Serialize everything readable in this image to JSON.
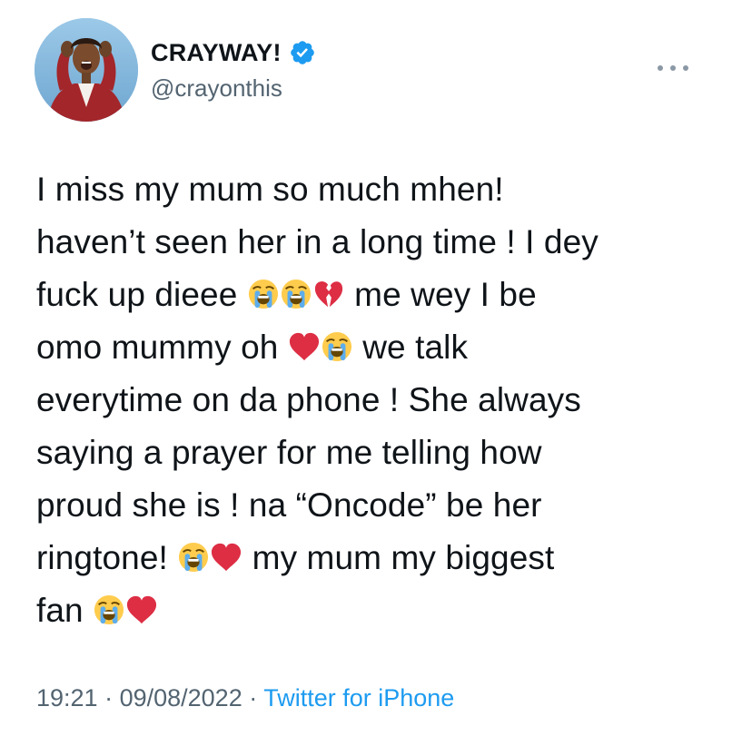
{
  "author": {
    "display_name": "CRAYWAY!",
    "handle": "@crayonthis",
    "verified": true
  },
  "tweet": {
    "lines": [
      [
        {
          "t": "text",
          "v": "I miss my mum so much mhen!"
        }
      ],
      [
        {
          "t": "text",
          "v": "haven’t seen her in a long time ! I dey"
        }
      ],
      [
        {
          "t": "text",
          "v": "fuck up dieee "
        },
        {
          "t": "emoji",
          "v": "crying-face"
        },
        {
          "t": "emoji",
          "v": "crying-face"
        },
        {
          "t": "emoji",
          "v": "broken-heart"
        },
        {
          "t": "text",
          "v": " me wey I be"
        }
      ],
      [
        {
          "t": "text",
          "v": "omo mummy oh "
        },
        {
          "t": "emoji",
          "v": "red-heart"
        },
        {
          "t": "emoji",
          "v": "crying-face"
        },
        {
          "t": "text",
          "v": " we talk"
        }
      ],
      [
        {
          "t": "text",
          "v": "everytime on da phone ! She always"
        }
      ],
      [
        {
          "t": "text",
          "v": "saying a prayer for me telling how"
        }
      ],
      [
        {
          "t": "text",
          "v": "proud she is ! na “Oncode” be her"
        }
      ],
      [
        {
          "t": "text",
          "v": "ringtone! "
        },
        {
          "t": "emoji",
          "v": "crying-face"
        },
        {
          "t": "emoji",
          "v": "red-heart"
        },
        {
          "t": "text",
          "v": " my mum my biggest"
        }
      ],
      [
        {
          "t": "text",
          "v": "fan "
        },
        {
          "t": "emoji",
          "v": "crying-face"
        },
        {
          "t": "emoji",
          "v": "red-heart"
        }
      ]
    ]
  },
  "meta": {
    "time": "19:21",
    "separator": " · ",
    "date": "09/08/2022",
    "source": "Twitter for iPhone"
  },
  "colors": {
    "text": "#0f1419",
    "secondary": "#536471",
    "accent": "#1d9bf0"
  },
  "icons": {
    "verified": "verified-badge-icon",
    "more": "more-dots-icon"
  }
}
